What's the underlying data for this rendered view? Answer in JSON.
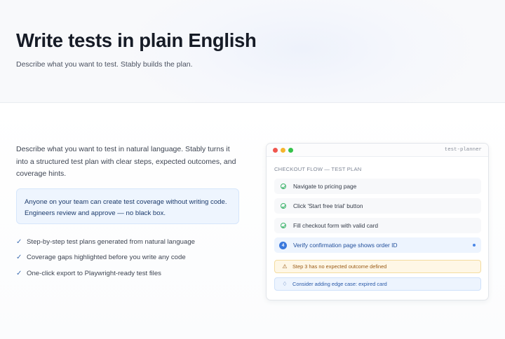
{
  "hero": {
    "title": "Write tests in plain English",
    "subtitle": "Describe what you want to test. Stably builds the plan."
  },
  "section": {
    "intro": "Describe what you want to test in natural language. Stably turns it into a structured test plan with clear steps, expected outcomes, and coverage hints.",
    "callout": "Anyone on your team can create test coverage without writing code. Engineers review and approve — no black box.",
    "features": [
      "Step-by-step test plans generated from natural language",
      "Coverage gaps highlighted before you write any code",
      "One-click export to Playwright-ready test files"
    ]
  },
  "window": {
    "title": "test-planner",
    "plan_title": "CHECKOUT FLOW — TEST PLAN",
    "steps": [
      {
        "label": "Navigate to pricing page",
        "status": "done"
      },
      {
        "label": "Click 'Start free trial' button",
        "status": "done"
      },
      {
        "label": "Fill checkout form with valid card",
        "status": "done"
      },
      {
        "label": "Verify confirmation page shows order ID",
        "status": "active",
        "number": "4"
      }
    ],
    "warning": "Step 3 has no expected outcome defined",
    "tip": "Consider adding edge case: expired card"
  },
  "colors": {
    "accent": "#3a78dd",
    "success": "#3cb36a",
    "warning": "#f5b52d"
  }
}
